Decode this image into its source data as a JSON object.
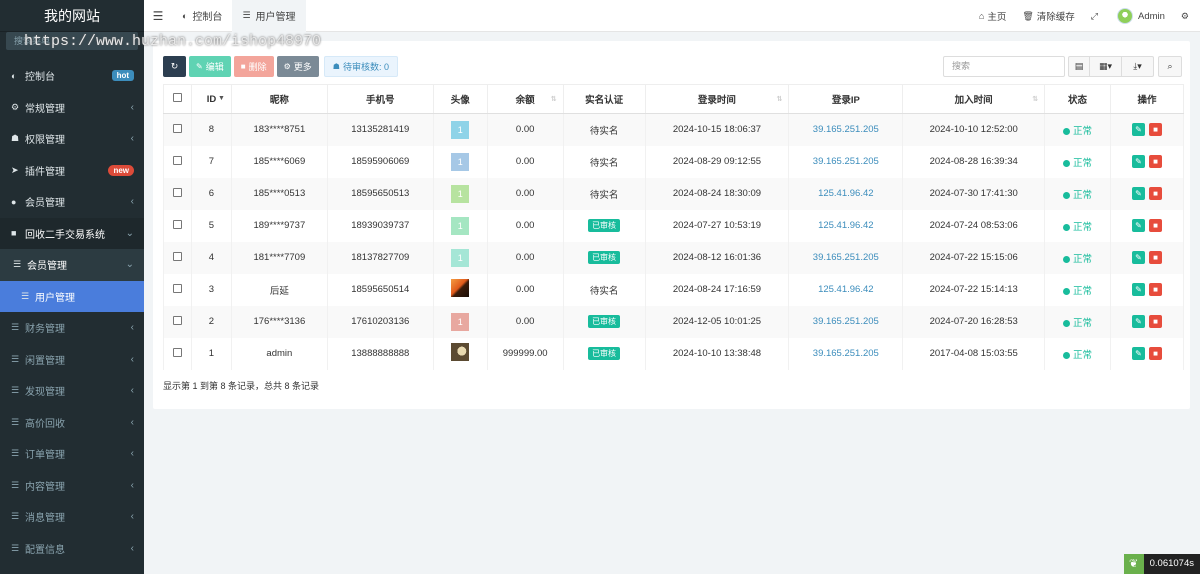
{
  "brand": "我的网站",
  "watermark": "https://www.huzhan.com/ishop48970",
  "side_search_placeholder": "搜索菜单",
  "menu": [
    {
      "icon": "dashboard-icon",
      "glyph": "◐",
      "label": "控制台",
      "badge": "hot",
      "badge_type": "hot",
      "style": ""
    },
    {
      "icon": "cogs-icon",
      "glyph": "⚙",
      "label": "常规管理",
      "chev": "‹",
      "style": ""
    },
    {
      "icon": "group-icon",
      "glyph": "☗",
      "label": "权限管理",
      "chev": "‹",
      "style": ""
    },
    {
      "icon": "rocket-icon",
      "glyph": "➤",
      "label": "插件管理",
      "badge": "new",
      "badge_type": "new",
      "style": ""
    },
    {
      "icon": "user-circle-icon",
      "glyph": "●",
      "label": "会员管理",
      "chev": "‹",
      "style": ""
    },
    {
      "icon": "folder-icon",
      "glyph": "■",
      "label": "回收二手交易系统",
      "chev": "⌄",
      "style": "open"
    },
    {
      "icon": "list-icon",
      "glyph": "☰",
      "label": "会员管理",
      "chev": "⌄",
      "style": "sub"
    },
    {
      "icon": "list-icon",
      "glyph": "☰",
      "label": "用户管理",
      "style": "active"
    },
    {
      "icon": "list-icon",
      "glyph": "☰",
      "label": "财务管理",
      "chev": "‹",
      "style": "dim"
    },
    {
      "icon": "list-icon",
      "glyph": "☰",
      "label": "闲置管理",
      "chev": "‹",
      "style": "dim"
    },
    {
      "icon": "list-icon",
      "glyph": "☰",
      "label": "发现管理",
      "chev": "‹",
      "style": "dim"
    },
    {
      "icon": "list-icon",
      "glyph": "☰",
      "label": "高价回收",
      "chev": "‹",
      "style": "dim"
    },
    {
      "icon": "list-icon",
      "glyph": "☰",
      "label": "订单管理",
      "chev": "‹",
      "style": "dim"
    },
    {
      "icon": "list-icon",
      "glyph": "☰",
      "label": "内容管理",
      "chev": "‹",
      "style": "dim"
    },
    {
      "icon": "list-icon",
      "glyph": "☰",
      "label": "消息管理",
      "chev": "‹",
      "style": "dim"
    },
    {
      "icon": "list-icon",
      "glyph": "☰",
      "label": "配置信息",
      "chev": "‹",
      "style": "dim"
    }
  ],
  "header": {
    "tabs": [
      {
        "label": "控制台",
        "glyph": "◐",
        "icon": "dashboard-icon",
        "active": false
      },
      {
        "label": "用户管理",
        "glyph": "☰",
        "icon": "list-icon",
        "active": true
      }
    ],
    "home": "主页",
    "clear_cache": "清除缓存",
    "user": "Admin"
  },
  "toolbar": {
    "edit": "编辑",
    "delete": "删除",
    "more": "更多",
    "pending": "待审核数: 0",
    "search_placeholder": "搜索"
  },
  "table": {
    "columns": [
      "ID",
      "昵称",
      "手机号",
      "头像",
      "余额",
      "实名认证",
      "登录时间",
      "登录IP",
      "加入时间",
      "状态",
      "操作"
    ],
    "rows": [
      {
        "id": "8",
        "nick": "183****8751",
        "phone": "13135281419",
        "avatar": "1",
        "avatar_color": "#8fd3e8",
        "balance": "0.00",
        "verify": "待实名",
        "verified": false,
        "login_time": "2024-10-15 18:06:37",
        "ip": "39.165.251.205",
        "join_time": "2024-10-10 12:52:00",
        "status": "正常"
      },
      {
        "id": "7",
        "nick": "185****6069",
        "phone": "18595906069",
        "avatar": "1",
        "avatar_color": "#a6c8e6",
        "balance": "0.00",
        "verify": "待实名",
        "verified": false,
        "login_time": "2024-08-29 09:12:55",
        "ip": "39.165.251.205",
        "join_time": "2024-08-28 16:39:34",
        "status": "正常"
      },
      {
        "id": "6",
        "nick": "185****0513",
        "phone": "18595650513",
        "avatar": "1",
        "avatar_color": "#b7e3a0",
        "balance": "0.00",
        "verify": "待实名",
        "verified": false,
        "login_time": "2024-08-24 18:30:09",
        "ip": "125.41.96.42",
        "join_time": "2024-07-30 17:41:30",
        "status": "正常"
      },
      {
        "id": "5",
        "nick": "189****9737",
        "phone": "18939039737",
        "avatar": "1",
        "avatar_color": "#a5e6c2",
        "balance": "0.00",
        "verify": "已审核",
        "verified": true,
        "login_time": "2024-07-27 10:53:19",
        "ip": "125.41.96.42",
        "join_time": "2024-07-24 08:53:06",
        "status": "正常"
      },
      {
        "id": "4",
        "nick": "181****7709",
        "phone": "18137827709",
        "avatar": "1",
        "avatar_color": "#a5e6d6",
        "balance": "0.00",
        "verify": "已审核",
        "verified": true,
        "login_time": "2024-08-12 16:01:36",
        "ip": "39.165.251.205",
        "join_time": "2024-07-22 15:15:06",
        "status": "正常"
      },
      {
        "id": "3",
        "nick": "后延",
        "phone": "18595650514",
        "avatar": "",
        "avatar_photo": "photo1",
        "balance": "0.00",
        "verify": "待实名",
        "verified": false,
        "login_time": "2024-08-24 17:16:59",
        "ip": "125.41.96.42",
        "join_time": "2024-07-22 15:14:13",
        "status": "正常"
      },
      {
        "id": "2",
        "nick": "176****3136",
        "phone": "17610203136",
        "avatar": "1",
        "avatar_color": "#e8a8a0",
        "balance": "0.00",
        "verify": "已审核",
        "verified": true,
        "login_time": "2024-12-05 10:01:25",
        "ip": "39.165.251.205",
        "join_time": "2024-07-20 16:28:53",
        "status": "正常"
      },
      {
        "id": "1",
        "nick": "admin",
        "phone": "13888888888",
        "avatar": "",
        "avatar_photo": "photo2",
        "balance": "999999.00",
        "verify": "已审核",
        "verified": true,
        "login_time": "2024-10-10 13:38:48",
        "ip": "39.165.251.205",
        "join_time": "2017-04-08 15:03:55",
        "status": "正常"
      }
    ]
  },
  "pagination_text": "显示第 1 到第 8 条记录，总共 8 条记录",
  "timer": "0.061074s"
}
